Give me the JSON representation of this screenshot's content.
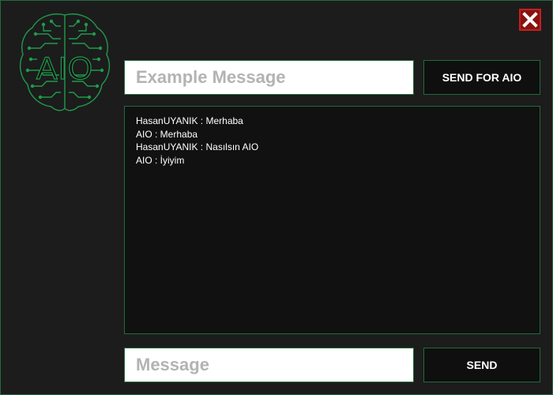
{
  "window": {
    "close_icon": "close-x-icon",
    "logo": {
      "text": "AIO",
      "icon": "brain-circuit-icon",
      "color": "#1f9a4c"
    }
  },
  "top_input": {
    "placeholder": "Example Message",
    "value": ""
  },
  "send_for_aio_button": {
    "label": "SEND FOR AIO"
  },
  "chat": {
    "messages": [
      "HasanUYANIK : Merhaba",
      "AIO : Merhaba",
      "HasanUYANIK : Nasılsın AIO",
      "AIO : İyiyim"
    ]
  },
  "bottom_input": {
    "placeholder": "Message",
    "value": ""
  },
  "send_button": {
    "label": "SEND"
  },
  "colors": {
    "background": "#1c1c1c",
    "accent_border": "#1f6b3c",
    "close_red": "#8a1010",
    "button_bg": "#0f0f0f"
  }
}
